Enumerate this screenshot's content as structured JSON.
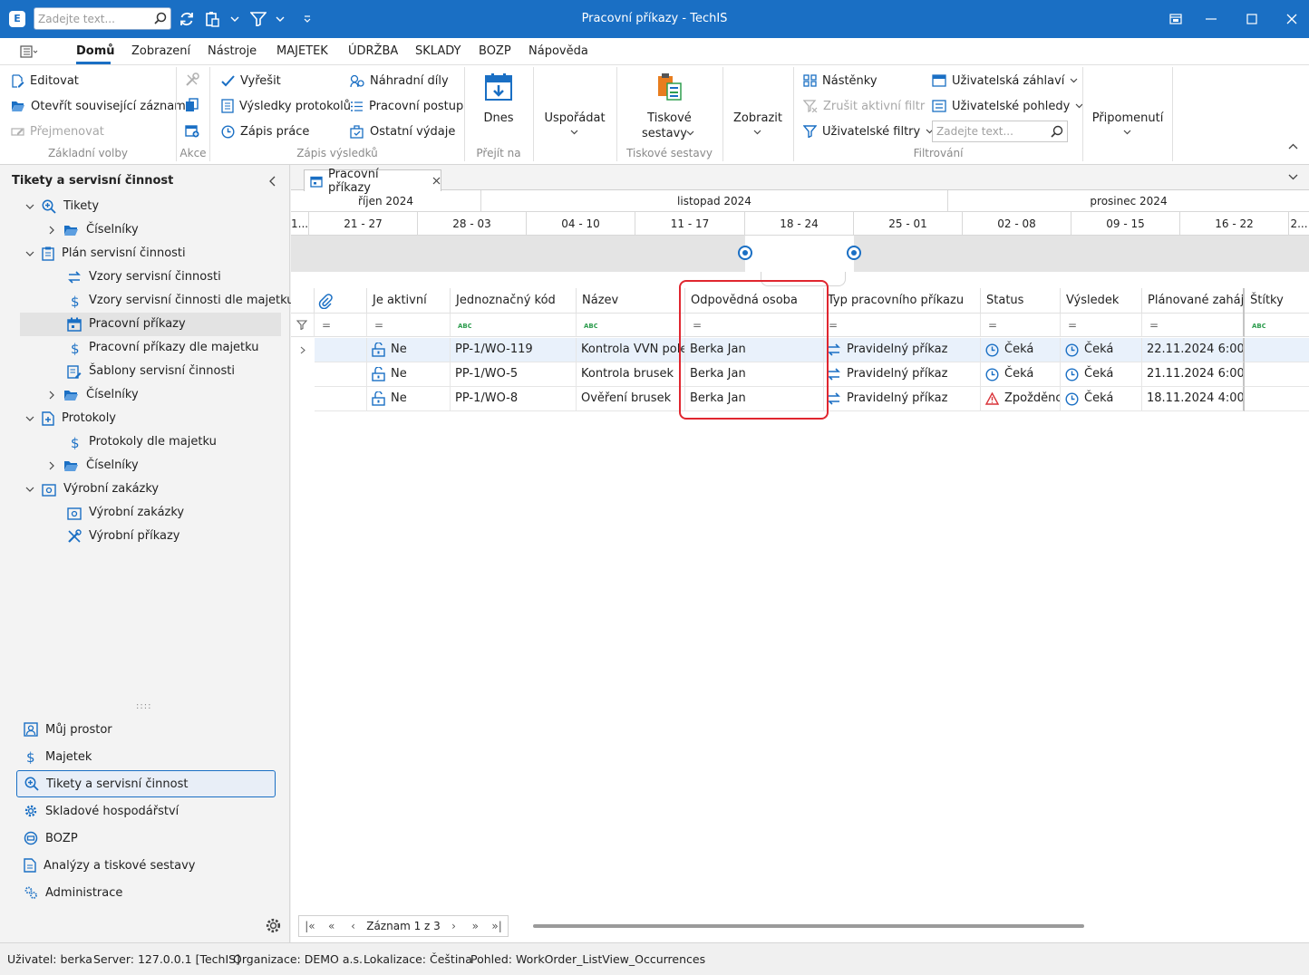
{
  "titlebar": {
    "title": "Pracovní příkazy - TechIS",
    "search_placeholder": "Zadejte text...",
    "app_icon": "E"
  },
  "menu": [
    "Domů",
    "Zobrazení",
    "Nástroje",
    "MAJETEK",
    "ÚDRŽBA",
    "SKLADY",
    "BOZP",
    "Nápověda"
  ],
  "ribbon": {
    "basic": {
      "edit": "Editovat",
      "open_related": "Otevřít související záznam",
      "rename": "Přejmenovat",
      "label": "Základní volby"
    },
    "actions": {
      "label": "Akce"
    },
    "results": {
      "resolve": "Vyřešit",
      "protocol_results": "Výsledky protokolů",
      "work_log": "Zápis práce",
      "spare_parts": "Náhradní díly",
      "work_procedure": "Pracovní postup",
      "other_expenses": "Ostatní výdaje",
      "label": "Zápis výsledků"
    },
    "goto": {
      "today": "Dnes",
      "label": "Přejít na"
    },
    "arrange": {
      "label": "Uspořádat"
    },
    "print": {
      "line1": "Tiskové",
      "line2": "sestavy",
      "label": "Tiskové sestavy"
    },
    "show": {
      "label": "Zobrazit"
    },
    "filter": {
      "boards": "Nástěnky",
      "cancel_filter": "Zrušit aktivní filtr",
      "user_filters": "Uživatelské filtry",
      "user_headers": "Uživatelská záhlaví",
      "user_views": "Uživatelské pohledy",
      "search_placeholder": "Zadejte text...",
      "label": "Filtrování"
    },
    "reminders": {
      "label": "Připomenutí"
    }
  },
  "sidebar": {
    "title": "Tikety a servisní činnost",
    "tree": [
      {
        "label": "Tikety",
        "level": 1
      },
      {
        "label": "Číselníky",
        "level": 2
      },
      {
        "label": "Plán servisní činnosti",
        "level": 1
      },
      {
        "label": "Vzory servisní činnosti",
        "level": 2
      },
      {
        "label": "Vzory servisní činnosti dle majetku",
        "level": 2
      },
      {
        "label": "Pracovní příkazy",
        "level": 2
      },
      {
        "label": "Pracovní příkazy dle majetku",
        "level": 2
      },
      {
        "label": "Šablony servisní činnosti",
        "level": 2
      },
      {
        "label": "Číselníky",
        "level": 2
      },
      {
        "label": "Protokoly",
        "level": 1
      },
      {
        "label": "Protokoly dle majetku",
        "level": 2
      },
      {
        "label": "Číselníky",
        "level": 2
      },
      {
        "label": "Výrobní zakázky",
        "level": 1
      },
      {
        "label": "Výrobní zakázky",
        "level": 2
      },
      {
        "label": "Výrobní příkazy",
        "level": 2
      }
    ],
    "nav": [
      "Můj prostor",
      "Majetek",
      "Tikety a servisní činnost",
      "Skladové hospodářství",
      "BOZP",
      "Analýzy a tiskové sestavy",
      "Administrace"
    ],
    "grip": "::::"
  },
  "doc_tab": {
    "label": "Pracovní příkazy"
  },
  "timeline": {
    "months": [
      "říjen 2024",
      "listopad 2024",
      "prosinec 2024"
    ],
    "weeks": [
      "1...",
      "21 - 27",
      "28 - 03",
      "04 - 10",
      "11 - 17",
      "18 - 24",
      "25 - 01",
      "02 - 08",
      "09 - 15",
      "16 - 22",
      "2..."
    ]
  },
  "grid": {
    "columns": [
      "Je aktivní",
      "Jednoznačný kód",
      "Název",
      "Odpovědná osoba",
      "Typ pracovního příkazu",
      "Status",
      "Výsledek",
      "Plánované zahájení",
      "Štítky"
    ],
    "filter_eq": "=",
    "rows": [
      {
        "active": "Ne",
        "code": "PP-1/WO-119",
        "name": "Kontrola VVN pole",
        "person": "Berka Jan",
        "type": "Pravidelný příkaz",
        "status": "Čeká",
        "status_icon": "clock-icon",
        "result": "Čeká",
        "start": "22.11.2024 6:00"
      },
      {
        "active": "Ne",
        "code": "PP-1/WO-5",
        "name": "Kontrola brusek",
        "person": "Berka Jan",
        "type": "Pravidelný příkaz",
        "status": "Čeká",
        "status_icon": "clock-icon",
        "result": "Čeká",
        "start": "21.11.2024 6:00"
      },
      {
        "active": "Ne",
        "code": "PP-1/WO-8",
        "name": "Ověření brusek",
        "person": "Berka Jan",
        "type": "Pravidelný příkaz",
        "status": "Zpožděno",
        "status_icon": "warning-icon",
        "result": "Čeká",
        "start": "18.11.2024 4:00"
      }
    ]
  },
  "pager": {
    "text": "Záznam 1 z 3"
  },
  "statusbar": {
    "user": "Uživatel: berka",
    "server": "Server: 127.0.0.1 [TechIS]",
    "org": "Organizace: DEMO a.s.",
    "locale": "Lokalizace: Čeština",
    "view": "Pohled: WorkOrder_ListView_Occurrences"
  },
  "colors": {
    "accent": "#1a6fc4",
    "highlight": "#e0262f",
    "warning": "#d9343a",
    "print_icon": "#e87d1e",
    "print_icon_green": "#2e9d4f"
  }
}
